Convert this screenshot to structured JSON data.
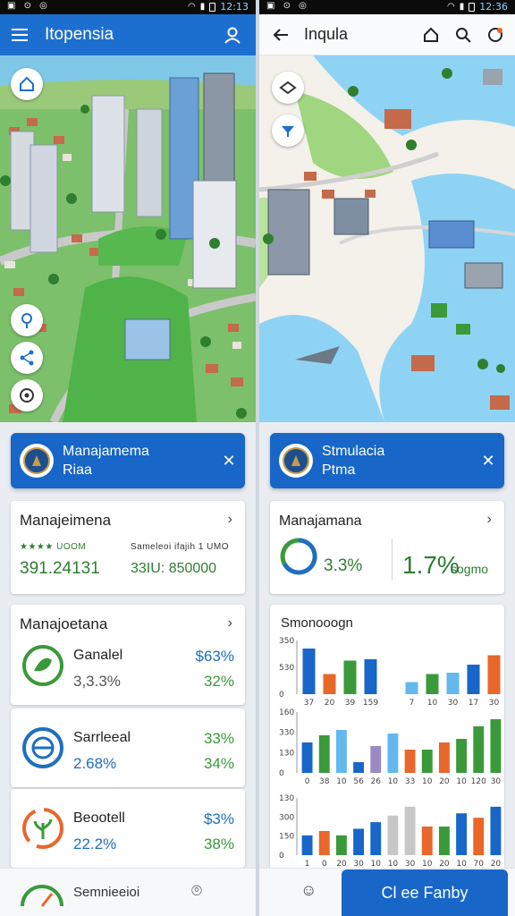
{
  "colors": {
    "primary": "#1766c8",
    "green": "#3a9a3a",
    "blue": "#1f6fbf",
    "orange": "#e8672a"
  },
  "left": {
    "status": {
      "time": "12:13"
    },
    "appbar": {
      "title": "Itopensia",
      "menu_icon": "hamburger-icon",
      "profile_icon": "person-icon"
    },
    "map_icons": [
      "home-map-icon",
      "location-pin-icon",
      "share-icon",
      "target-icon"
    ],
    "banner": {
      "title": "Manajamema",
      "subtitle": "Riaa",
      "close": "✕"
    },
    "summary": {
      "title": "Manajeimena",
      "label_left": "★★★★ UOOM",
      "label_right": "Sameleoi ifajih 1 UMO",
      "value_left": "391.24131",
      "value_right": "33IU: 850000"
    },
    "list_title": "Manajoetana",
    "items": [
      {
        "name": "Ganalel",
        "sub": "3,3.3%",
        "p1": "$63%",
        "p2": "32%",
        "ring": "#3a9a3a"
      },
      {
        "name": "Sarrleeal",
        "sub": "2.68%",
        "p1": "33%",
        "p2": "34%",
        "ring": "#1f6fbf"
      },
      {
        "name": "Beootell",
        "sub": "22.2%",
        "p1": "$3%",
        "p2": "38%",
        "ring": "#e8672a"
      }
    ],
    "bottom": {
      "label": "Semnieeioi"
    }
  },
  "right": {
    "status": {
      "time": "12:36"
    },
    "appbar": {
      "title": "Inqula",
      "back_icon": "back-arrow-icon"
    },
    "banner": {
      "title": "Stmulacia",
      "subtitle": "Ptma",
      "close": "✕"
    },
    "summary": {
      "title": "Manajamana",
      "value_left": "3.3%",
      "value_right": "1.7%",
      "unit_right": "sogmo"
    },
    "charts": {
      "title": "Smonooogn",
      "chart_data": [
        {
          "type": "bar",
          "yticks": [
            "350",
            "530",
            "0"
          ],
          "categories": [
            "37",
            "20",
            "39",
            "159",
            "",
            "7",
            "10",
            "30",
            "17",
            "30"
          ],
          "values": [
            3.4,
            1.5,
            2.5,
            2.6,
            0,
            0.9,
            1.5,
            1.6,
            2.2,
            2.9
          ],
          "colors": [
            "#1766c8",
            "#e8672a",
            "#3a9a3a",
            "#1766c8",
            "#ffffff",
            "#63b8ee",
            "#3a9a3a",
            "#63b8ee",
            "#1766c8",
            "#e8672a"
          ],
          "ylim": [
            0,
            4
          ]
        },
        {
          "type": "bar",
          "yticks": [
            "160",
            "330",
            "130",
            "0"
          ],
          "categories": [
            "0",
            "38",
            "10",
            "56",
            "26",
            "10",
            "33",
            "10",
            "20",
            "10",
            "120",
            "30"
          ],
          "values": [
            1.7,
            2.1,
            2.4,
            0.6,
            1.5,
            2.2,
            1.3,
            1.3,
            1.7,
            1.9,
            2.6,
            3.0
          ],
          "colors": [
            "#1766c8",
            "#3a9a3a",
            "#63b8ee",
            "#1766c8",
            "#9b8ac4",
            "#63b8ee",
            "#e8672a",
            "#3a9a3a",
            "#e8672a",
            "#3a9a3a",
            "#3a9a3a",
            "#3a9a3a"
          ],
          "ylim": [
            0,
            3.4
          ]
        },
        {
          "type": "bar",
          "yticks": [
            "130",
            "300",
            "150",
            "0"
          ],
          "categories": [
            "1",
            "0",
            "20",
            "30",
            "10",
            "10",
            "30",
            "10",
            "20",
            "10",
            "70",
            "20"
          ],
          "values": [
            0.9,
            1.1,
            0.9,
            1.2,
            1.5,
            1.8,
            2.2,
            1.3,
            1.3,
            1.9,
            1.7,
            2.2
          ],
          "colors": [
            "#1766c8",
            "#e8672a",
            "#3a9a3a",
            "#1766c8",
            "#1766c8",
            "#c7c7c7",
            "#c7c7c7",
            "#e8672a",
            "#3a9a3a",
            "#1766c8",
            "#e8672a",
            "#1766c8"
          ],
          "ylim": [
            0,
            2.6
          ]
        }
      ]
    },
    "bottom": {
      "cta": "Cl ee Fanby"
    }
  }
}
